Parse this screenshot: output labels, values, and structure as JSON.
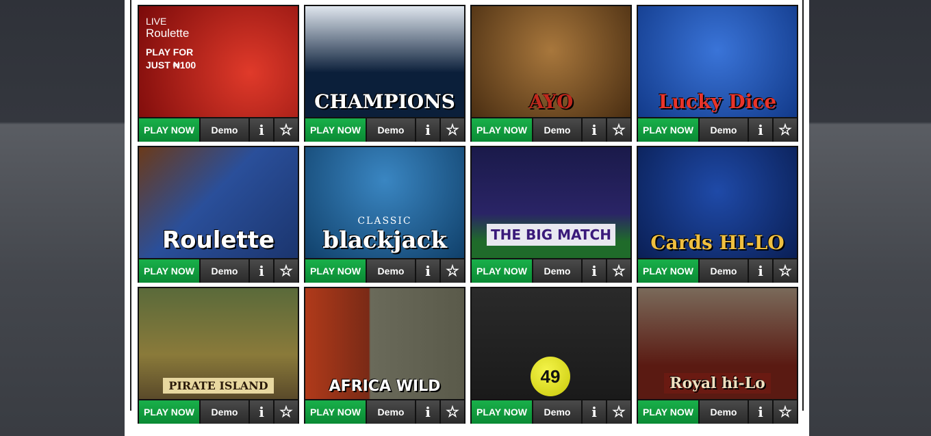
{
  "buttons": {
    "play_now": "PLAY NOW",
    "demo": "Demo",
    "info_glyph": "i",
    "fav_glyph": "☆"
  },
  "games": [
    {
      "id": "live-roulette",
      "title": "",
      "overlay": "LIVE",
      "subtitle": "Roulette",
      "promo_line1": "PLAY FOR",
      "promo_line2": "JUST ₦100",
      "bg": "#8a0d0d"
    },
    {
      "id": "champions",
      "title": "CHAMPIONS",
      "bg": "#0b1f3a"
    },
    {
      "id": "ayo",
      "title": "AYO",
      "bg": "#6b4a24"
    },
    {
      "id": "lucky-dice",
      "title": "Lucky Dice",
      "bg": "#1f4fa8"
    },
    {
      "id": "roulette",
      "title": "Roulette",
      "bg": "#2a3f7a"
    },
    {
      "id": "classic-blackjack",
      "title": "blackjack",
      "subtitle": "CLASSIC",
      "bg": "#1d5b8c"
    },
    {
      "id": "the-big-match",
      "title": "THE BIG MATCH",
      "bg": "#2a2466"
    },
    {
      "id": "cards-hi-lo",
      "title": "Cards HI-LO",
      "bg": "#0f2a6b"
    },
    {
      "id": "pirate-island",
      "title": "PIRATE ISLAND",
      "bg": "#6b5a2a"
    },
    {
      "id": "africa-wild",
      "title": "AFRICA WILD",
      "bg": "#7a2a16"
    },
    {
      "id": "49s",
      "title": "",
      "ball": "49",
      "bg": "#1c1c1c"
    },
    {
      "id": "royal-hi-lo",
      "title": "Royal hi-Lo",
      "bg": "#5a1a12"
    }
  ]
}
